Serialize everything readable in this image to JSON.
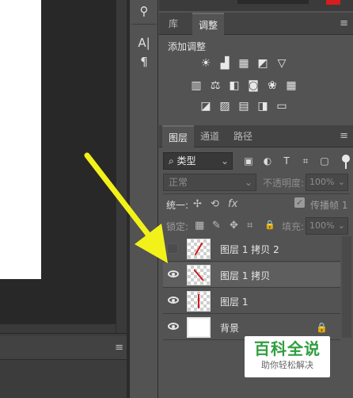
{
  "tool_strip": {
    "items": [
      {
        "icon": "stamp-icon",
        "glyph": "⚲"
      },
      {
        "icon": "character-icon",
        "glyph": "A|"
      },
      {
        "icon": "paragraph-icon",
        "glyph": "¶"
      }
    ]
  },
  "adjust_panel": {
    "tabs": [
      {
        "label": "库"
      },
      {
        "label": "调整"
      }
    ],
    "active_tab": "调整",
    "title": "添加调整",
    "row1": [
      "☀",
      "▟",
      "▦",
      "◩",
      "▽"
    ],
    "row2": [
      "▥",
      "⚖",
      "◧",
      "◙",
      "❀",
      "▦"
    ],
    "row3": [
      "◪",
      "▨",
      "▤",
      "◨",
      "▭"
    ]
  },
  "layers_panel": {
    "tabs": [
      {
        "label": "图层"
      },
      {
        "label": "通道"
      },
      {
        "label": "路径"
      }
    ],
    "active_tab": "图层",
    "filter_value": "⌕ 类型",
    "filter_icons": [
      "▣",
      "◐",
      "T",
      "⌗",
      "▢"
    ],
    "blend_mode": "正常",
    "opacity_label": "不透明度:",
    "opacity_value": "100%",
    "unify_label": "统一:",
    "unify_icons": [
      "✢",
      "⟲",
      "fx"
    ],
    "propagate_label": "传播帧 1",
    "lock_label": "锁定:",
    "lock_icons": [
      "▦",
      "✎",
      "✥",
      "⌗",
      "🔒"
    ],
    "fill_label": "填充:",
    "fill_value": "100%",
    "layers": [
      {
        "name": "图层 1 拷贝 2",
        "visible": false,
        "selected": false,
        "thumb": "transparent",
        "stroke_angle": 30,
        "locked": false
      },
      {
        "name": "图层 1 拷贝",
        "visible": true,
        "selected": true,
        "thumb": "transparent",
        "stroke_angle": -40,
        "locked": false
      },
      {
        "name": "图层 1",
        "visible": true,
        "selected": false,
        "thumb": "transparent",
        "stroke_angle": 0,
        "locked": false
      },
      {
        "name": "背景",
        "visible": true,
        "selected": false,
        "thumb": "white",
        "stroke_angle": 0,
        "locked": true
      }
    ]
  },
  "annotation": {
    "color": "#f2f21a"
  },
  "watermark": {
    "title": "百科全说",
    "subtitle": "助你轻松解决"
  },
  "colors": {
    "panel_bg": "#535353",
    "canvas_bg": "#282828",
    "accent_red": "#d61d1d"
  }
}
